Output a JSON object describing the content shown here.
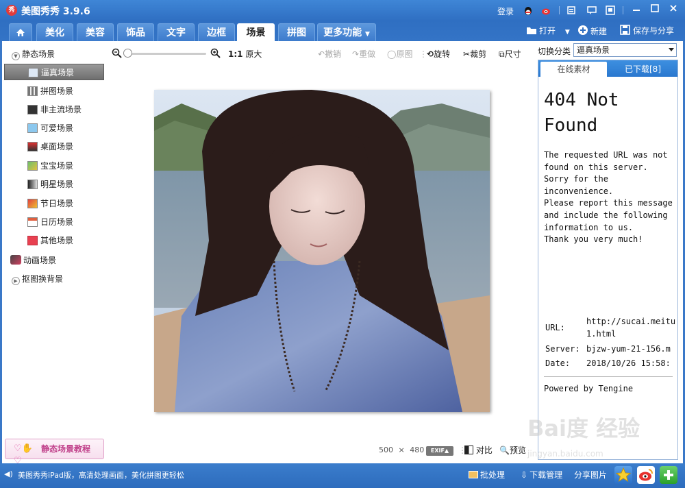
{
  "app": {
    "logo_text": "秀",
    "title": "美图秀秀 3.9.6",
    "login": "登录"
  },
  "tabs": [
    {
      "label": "美化"
    },
    {
      "label": "美容"
    },
    {
      "label": "饰品"
    },
    {
      "label": "文字"
    },
    {
      "label": "边框"
    },
    {
      "label": "场景"
    },
    {
      "label": "拼图"
    }
  ],
  "active_tab": "场景",
  "more_tab": "更多功能",
  "top_actions": {
    "open": "打开",
    "new": "新建",
    "save_share": "保存与分享"
  },
  "sidebar": {
    "static_group": "静态场景",
    "items": [
      {
        "label": "逼真场景",
        "icon": "realistic-scene-icon"
      },
      {
        "label": "拼图场景",
        "icon": "collage-scene-icon"
      },
      {
        "label": "非主流场景",
        "icon": "alternative-scene-icon"
      },
      {
        "label": "可爱场景",
        "icon": "cute-scene-icon"
      },
      {
        "label": "桌面场景",
        "icon": "desktop-scene-icon"
      },
      {
        "label": "宝宝场景",
        "icon": "baby-scene-icon"
      },
      {
        "label": "明星场景",
        "icon": "star-scene-icon"
      },
      {
        "label": "节日场景",
        "icon": "holiday-scene-icon"
      },
      {
        "label": "日历场景",
        "icon": "calendar-scene-icon"
      },
      {
        "label": "其他场景",
        "icon": "other-scene-icon"
      }
    ],
    "animated_group": "动画场景",
    "cutout_group": "抠图换背景",
    "tutorial": "静态场景教程"
  },
  "toolbar": {
    "zoom_ratio": "1:1",
    "original_size": "原大",
    "undo": "撤销",
    "redo": "重做",
    "original": "原图",
    "rotate": "旋转",
    "crop": "裁剪",
    "size": "尺寸"
  },
  "image_info": {
    "width": "500",
    "times": "×",
    "height": "480",
    "exif": "EXIF▲"
  },
  "bottom_tools": {
    "compare": "对比",
    "preview": "预览"
  },
  "right_panel": {
    "category_label": "切换分类",
    "category_value": "逼真场景",
    "tab_online": "在线素材",
    "tab_downloaded": "已下载[8]",
    "error_title": "404 Not Found",
    "error_body": "The requested URL was not found on this server. Sorry for the inconvenience.\nPlease report this message and include the following information to us.\nThank you very much!",
    "url_label": "URL:",
    "url_value": "http://sucai.meitu",
    "url_value2": "1.html",
    "server_label": "Server:",
    "server_value": "bjzw-yum-21-156.m",
    "date_label": "Date:",
    "date_value": "2018/10/26 15:58:",
    "powered": "Powered by Tengine"
  },
  "statusbar": {
    "ad_text": "美图秀秀iPad版，高清处理画面，美化拼图更轻松",
    "batch": "批处理",
    "download_manager": "下载管理",
    "share_image": "分享图片"
  },
  "watermark": {
    "text": "Bai度 经验",
    "sub": "jingyan.baidu.com"
  },
  "colors": {
    "chrome_blue": "#2f6fc2",
    "accent_pink": "#c0408a",
    "panel_tab_blue": "#2a78cf"
  }
}
